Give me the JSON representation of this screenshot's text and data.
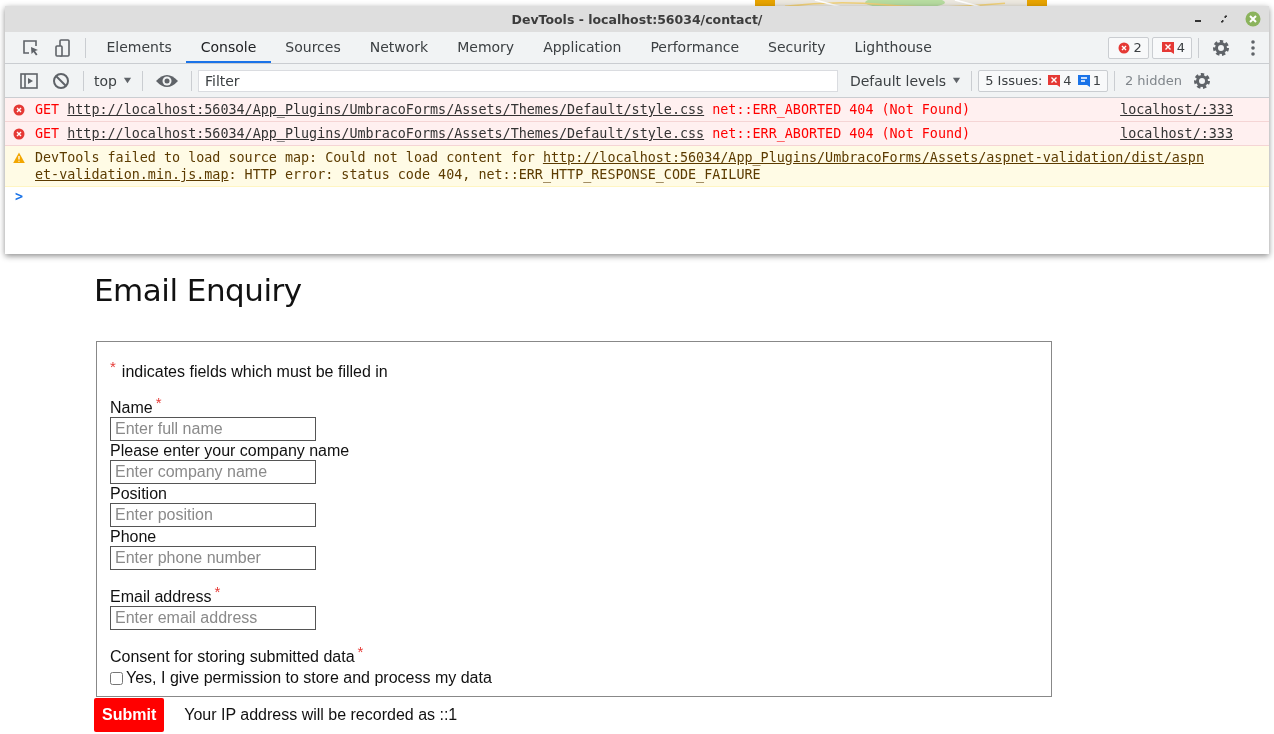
{
  "devtools": {
    "title": "DevTools - localhost:56034/contact/",
    "tabs": [
      {
        "label": "Elements",
        "selected": false
      },
      {
        "label": "Console",
        "selected": true
      },
      {
        "label": "Sources",
        "selected": false
      },
      {
        "label": "Network",
        "selected": false
      },
      {
        "label": "Memory",
        "selected": false
      },
      {
        "label": "Application",
        "selected": false
      },
      {
        "label": "Performance",
        "selected": false
      },
      {
        "label": "Security",
        "selected": false
      },
      {
        "label": "Lighthouse",
        "selected": false
      }
    ],
    "error_count": "2",
    "issue_count": "4",
    "toolbar": {
      "context": "top",
      "filter_placeholder": "Filter",
      "levels": "Default levels",
      "issues_label": "5 Issues:",
      "issues_errors": "4",
      "issues_info": "1",
      "hidden": "2 hidden"
    },
    "messages": [
      {
        "kind": "error",
        "method": "GET",
        "url": "http://localhost:56034/App_Plugins/UmbracoForms/Assets/Themes/Default/style.css",
        "text": "net::ERR_ABORTED 404 (Not Found)",
        "source": "localhost/:333"
      },
      {
        "kind": "error",
        "method": "GET",
        "url": "http://localhost:56034/App_Plugins/UmbracoForms/Assets/Themes/Default/style.css",
        "text": "net::ERR_ABORTED 404 (Not Found)",
        "source": "localhost/:333"
      },
      {
        "kind": "warning",
        "text": "DevTools failed to load source map: Could not load content for ",
        "url": "http://localhost:56034/App_Plugins/UmbracoForms/Assets/aspnet-validation/dist/aspn",
        "url_continued": "et-validation.min.js.map",
        "text_after": ": HTTP error: status code 404, net::ERR_HTTP_RESPONSE_CODE_FAILURE"
      }
    ],
    "prompt": ">"
  },
  "form": {
    "heading": "Email Enquiry",
    "required_mark": "*",
    "intro": "indicates fields which must be filled in",
    "fields": [
      {
        "label": "Name",
        "required": true,
        "placeholder": "Enter full name"
      },
      {
        "label": "Please enter your company name",
        "required": false,
        "placeholder": "Enter company name"
      },
      {
        "label": "Position",
        "required": false,
        "placeholder": "Enter position"
      },
      {
        "label": "Phone",
        "required": false,
        "placeholder": "Enter phone number"
      },
      {
        "label": "Email address",
        "required": true,
        "placeholder": "Enter email address"
      }
    ],
    "consent": {
      "label": "Consent for storing submitted data",
      "required": true,
      "checkbox_label": "Yes, I give permission to store and process my data",
      "checked": false
    },
    "submit": "Submit",
    "ip_note": "Your IP address will be recorded as ::1"
  }
}
